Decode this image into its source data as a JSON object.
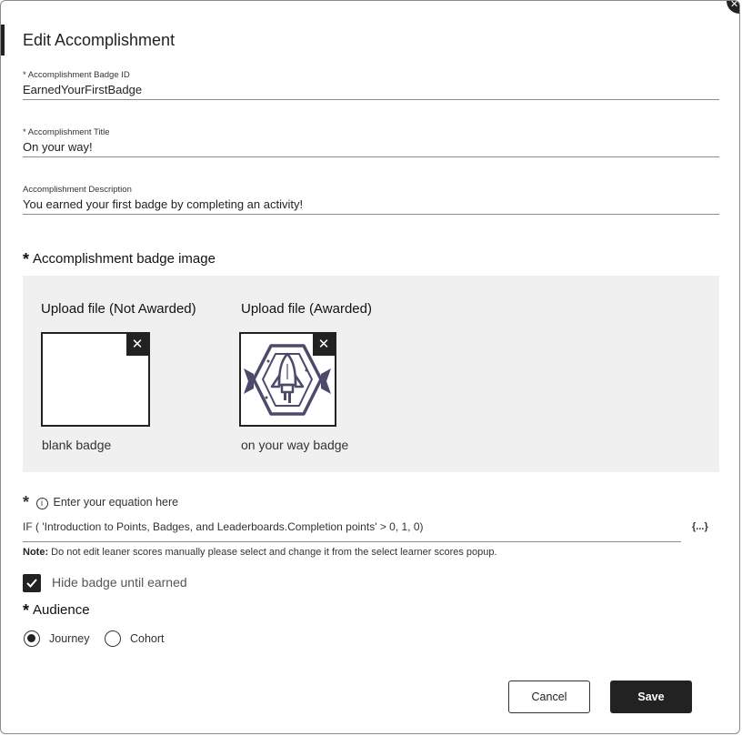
{
  "dialog": {
    "title": "Edit Accomplishment",
    "close_icon": "close-icon"
  },
  "fields": {
    "badge_id": {
      "label": "* Accomplishment Badge ID",
      "value": "EarnedYourFirstBadge"
    },
    "title": {
      "label": "* Accomplishment Title",
      "value": "On your way!"
    },
    "description": {
      "label": "Accomplishment Description",
      "value": "You earned your first badge by completing an activity!"
    }
  },
  "badge_image": {
    "required_mark": "*",
    "title": "Accomplishment badge image",
    "not_awarded": {
      "heading": "Upload file (Not Awarded)",
      "caption": "blank badge"
    },
    "awarded": {
      "heading": "Upload file (Awarded)",
      "caption": "on your way badge",
      "icon": "rocket-badge-icon"
    },
    "remove_label": "✕"
  },
  "equation": {
    "required_mark": "*",
    "label": "Enter your equation here",
    "value": "IF ( 'Introduction to Points, Badges, and Leaderboards.Completion points' > 0, 1, 0)",
    "picker_label": "{...}",
    "note_bold": "Note:",
    "note_text": " Do not edit leaner scores manually please select and change it from the select learner scores popup."
  },
  "hide_badge": {
    "label": "Hide badge until earned",
    "checked": true
  },
  "audience": {
    "required_mark": "*",
    "title": "Audience",
    "options": [
      {
        "label": "Journey",
        "selected": true
      },
      {
        "label": "Cohort",
        "selected": false
      }
    ]
  },
  "buttons": {
    "cancel": "Cancel",
    "save": "Save"
  },
  "colors": {
    "primary": "#222222",
    "panel": "#f0f0f0",
    "badge": "#4b4a6b"
  }
}
